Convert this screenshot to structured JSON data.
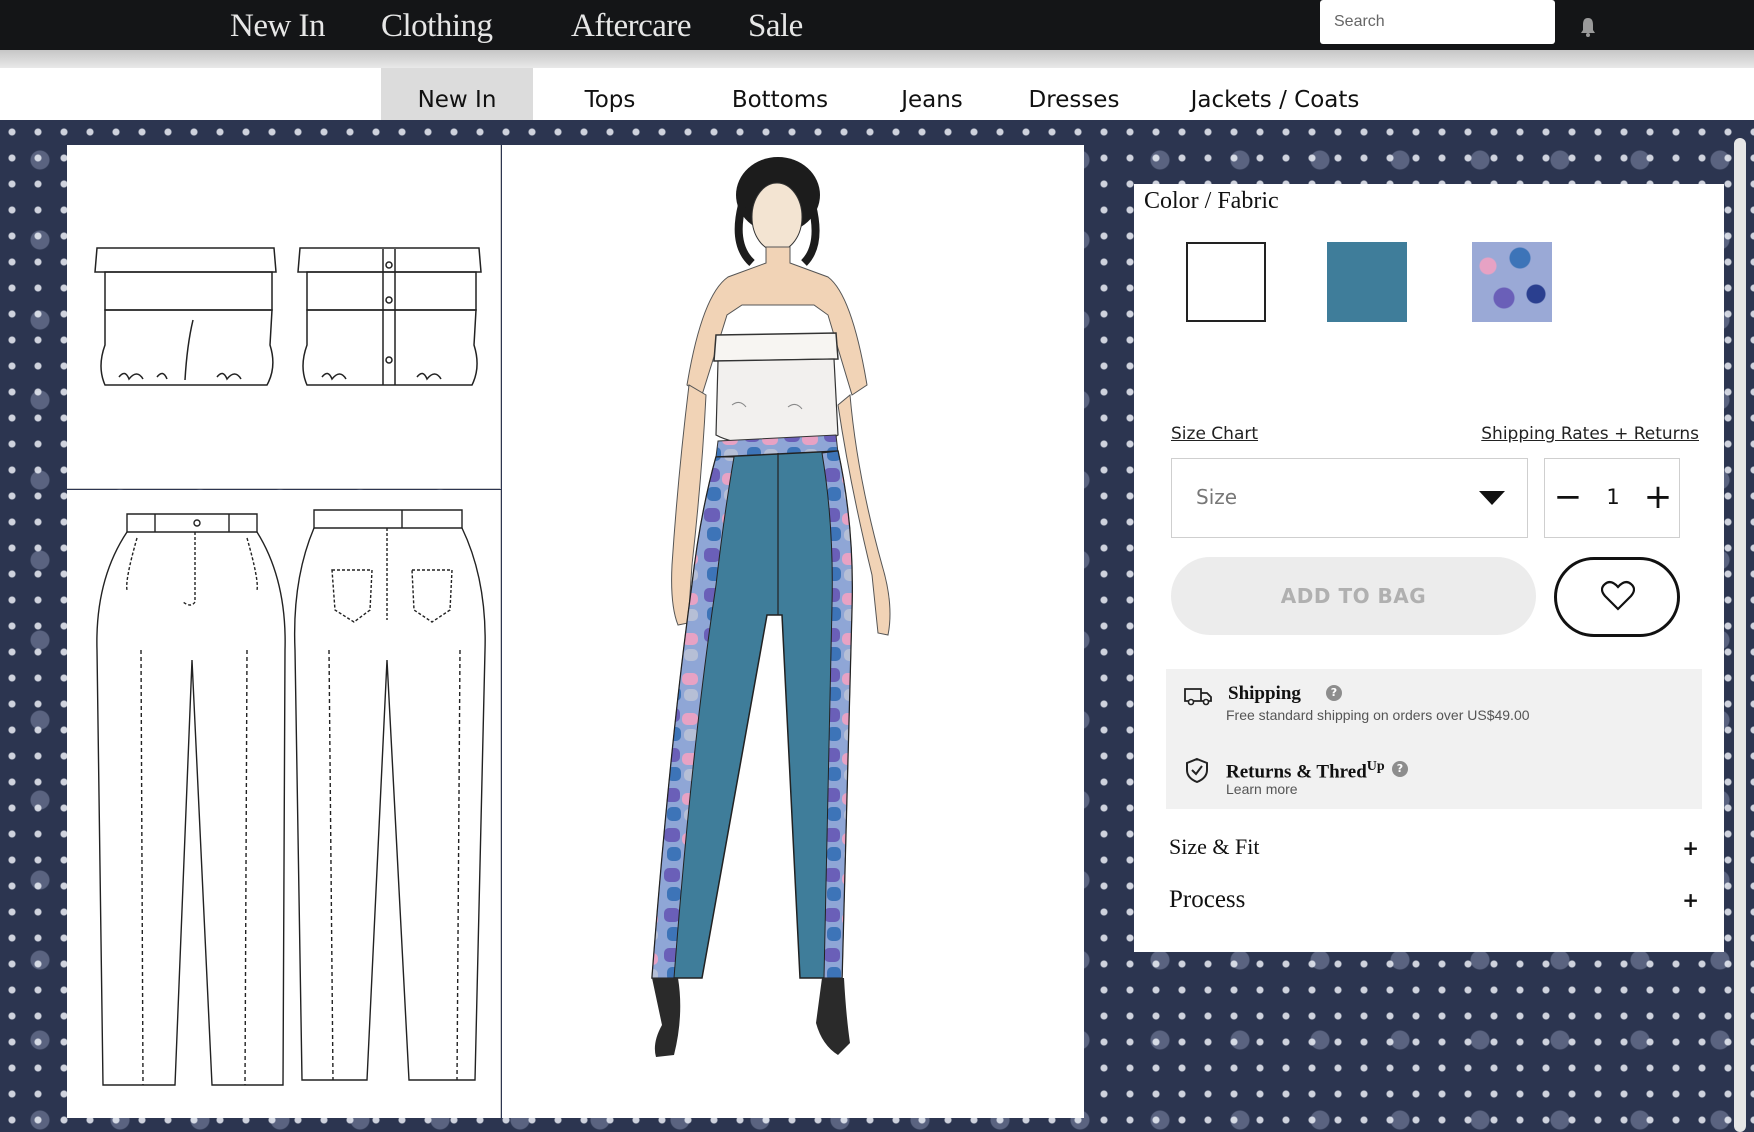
{
  "top_nav": {
    "items": [
      "New In",
      "Clothing",
      "Aftercare",
      "Sale"
    ],
    "search_placeholder": "Search"
  },
  "sub_nav": {
    "items": [
      "New In",
      "Tops",
      "Bottoms",
      "Jeans",
      "Dresses",
      "Jackets / Coats"
    ],
    "active": "New In"
  },
  "product": {
    "color_fabric_title": "Color / Fabric",
    "swatches": [
      {
        "name": "white",
        "color": "#ffffff"
      },
      {
        "name": "teal",
        "color": "#3f7d9a"
      },
      {
        "name": "painted print",
        "color": "#6b7fc0"
      }
    ],
    "size_chart_link": "Size Chart",
    "shipping_link": "Shipping Rates + Returns",
    "size_placeholder": "Size",
    "quantity": "1",
    "qty_minus": "−",
    "qty_plus": "+",
    "add_to_bag": "ADD TO BAG",
    "shipping": {
      "title": "Shipping",
      "subtitle": "Free standard shipping on orders over US$49.00"
    },
    "returns": {
      "title": "Returns & Thred",
      "title_sup": "Up",
      "subtitle": "Learn more"
    },
    "accordions": [
      {
        "label": "Size & Fit",
        "toggle": "+"
      },
      {
        "label": "Process",
        "toggle": "+"
      }
    ]
  },
  "colors": {
    "nav_bg": "#141517",
    "nav_text": "#e6e6e6",
    "fabric_bg": "#2c3550",
    "denim": "#3f7d9a",
    "add_to_bag_bg": "#ececec"
  }
}
